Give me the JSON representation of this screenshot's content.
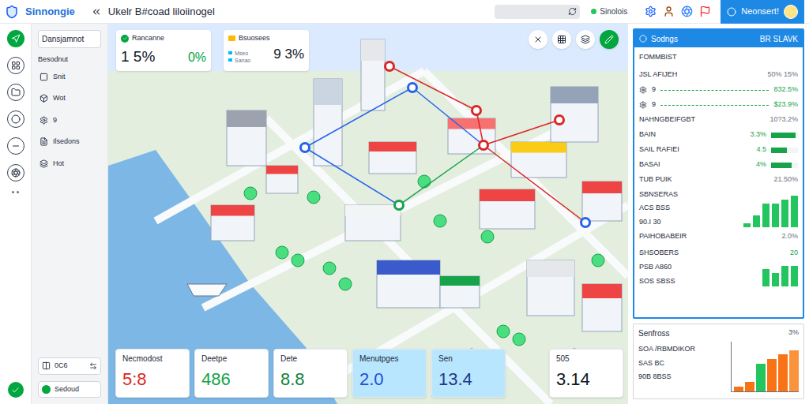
{
  "app": {
    "name": "Sinnongie",
    "title": "Ukelr B#coad liloiinogel"
  },
  "status": {
    "label": "Sinolois",
    "color": "#22c55e"
  },
  "user": {
    "name": "Neonsert!"
  },
  "rail": [
    {
      "selected": true
    },
    {
      "selected": false
    },
    {
      "selected": false
    },
    {
      "selected": false
    },
    {
      "selected": false
    },
    {
      "selected": false
    }
  ],
  "sidebar": {
    "header": "Dansjamnot",
    "section": "Besodnut",
    "items": [
      {
        "label": "Snit",
        "selected": false
      },
      {
        "label": "Wot",
        "selected": false
      },
      {
        "label": "9",
        "selected": false
      },
      {
        "label": "Ilsedons",
        "selected": false
      },
      {
        "label": "Hot",
        "selected": false
      }
    ],
    "footer": "0C6",
    "button": "Sedoud"
  },
  "map": {
    "card_a": {
      "title": "Rancanne",
      "value": "1 5%",
      "delta": "0%"
    },
    "card_b": {
      "title": "Bsuosees",
      "lines": [
        "Mseo",
        "Sanao"
      ],
      "value": "9 3%"
    },
    "pins": [
      {
        "color": "#dc2626"
      },
      {
        "color": "#2563eb"
      },
      {
        "color": "#dc2626"
      },
      {
        "color": "#dc2626"
      },
      {
        "color": "#dc2626"
      },
      {
        "color": "#2563eb"
      },
      {
        "color": "#16a34a"
      },
      {
        "color": "#2563eb"
      }
    ],
    "tiles": [
      {
        "label": "Necmodost",
        "value": "5:8",
        "color": "#dc2626",
        "selected": false
      },
      {
        "label": "Deetpe",
        "value": "486",
        "color": "#16a34a",
        "selected": false
      },
      {
        "label": "Dete",
        "value": "8.8",
        "color": "#15803d",
        "selected": false
      },
      {
        "label": "Menutpges",
        "value": "2.0",
        "color": "#1d4ed8",
        "selected": true
      },
      {
        "label": "Sen",
        "value": "13.4",
        "color": "#1e3a8a",
        "selected": true
      },
      {
        "label": "505",
        "value": "3.14",
        "color": "#111827",
        "selected": false
      }
    ]
  },
  "panel": {
    "title": "Sodngs",
    "meta": "BR SLAVK",
    "heading": "FOMMBIST",
    "rows": [
      {
        "label": "JSL AFIJEH",
        "value": "50% 15%",
        "kind": "text",
        "level": 0,
        "color": "#6b7280"
      },
      {
        "label": "9",
        "value": "832.5%",
        "kind": "trend",
        "level": 0,
        "color": "#16a34a"
      },
      {
        "label": "9",
        "value": "$23.9%",
        "kind": "trend",
        "level": 0,
        "color": "#16a34a"
      },
      {
        "label": "NAHNGBEIFGBT",
        "value": "10?3.2%",
        "kind": "text",
        "level": 0,
        "color": "#6b7280"
      },
      {
        "label": "BAIN",
        "value": "3.3%",
        "kind": "bar",
        "level": 0.9,
        "color": "#16a34a"
      },
      {
        "label": "SAIL RAFIEI",
        "value": "4.5",
        "kind": "bar",
        "level": 0.6,
        "color": "#16a34a"
      },
      {
        "label": "BASAI",
        "value": "4%",
        "kind": "bar",
        "level": 0.75,
        "color": "#16a34a"
      },
      {
        "label": "TUB PUIK",
        "value": "21.50%",
        "kind": "text",
        "level": 0,
        "color": "#6b7280"
      }
    ],
    "chart_a": {
      "labels": [
        "SBNSERAS",
        "ACS BSS",
        "90.I 30"
      ],
      "values": [
        1,
        3,
        6,
        6,
        7,
        8
      ]
    },
    "rows_b": [
      {
        "label": "PAIHOBABEIR",
        "value": "2.0%",
        "color": "#6b7280"
      },
      {
        "label": "SHSOBERS",
        "value": "20",
        "color": "#16a34a"
      }
    ],
    "chart_b": {
      "labels": [
        "PSB A860",
        "SOS SBSS"
      ],
      "values": [
        5,
        4,
        6,
        6
      ]
    }
  },
  "trend": {
    "title": "Senfross",
    "value": "3%",
    "labels": [
      "SOA /RBMDIKOR",
      "SAS BC",
      "90B 8BSS"
    ],
    "bars": [
      {
        "value": 1,
        "color": "#f97316"
      },
      {
        "value": 2,
        "color": "#f97316"
      },
      {
        "value": 6,
        "color": "#22c55e"
      },
      {
        "value": 7,
        "color": "#f97316"
      },
      {
        "value": 8,
        "color": "#f97316"
      },
      {
        "value": 9,
        "color": "#fb923c"
      }
    ]
  }
}
